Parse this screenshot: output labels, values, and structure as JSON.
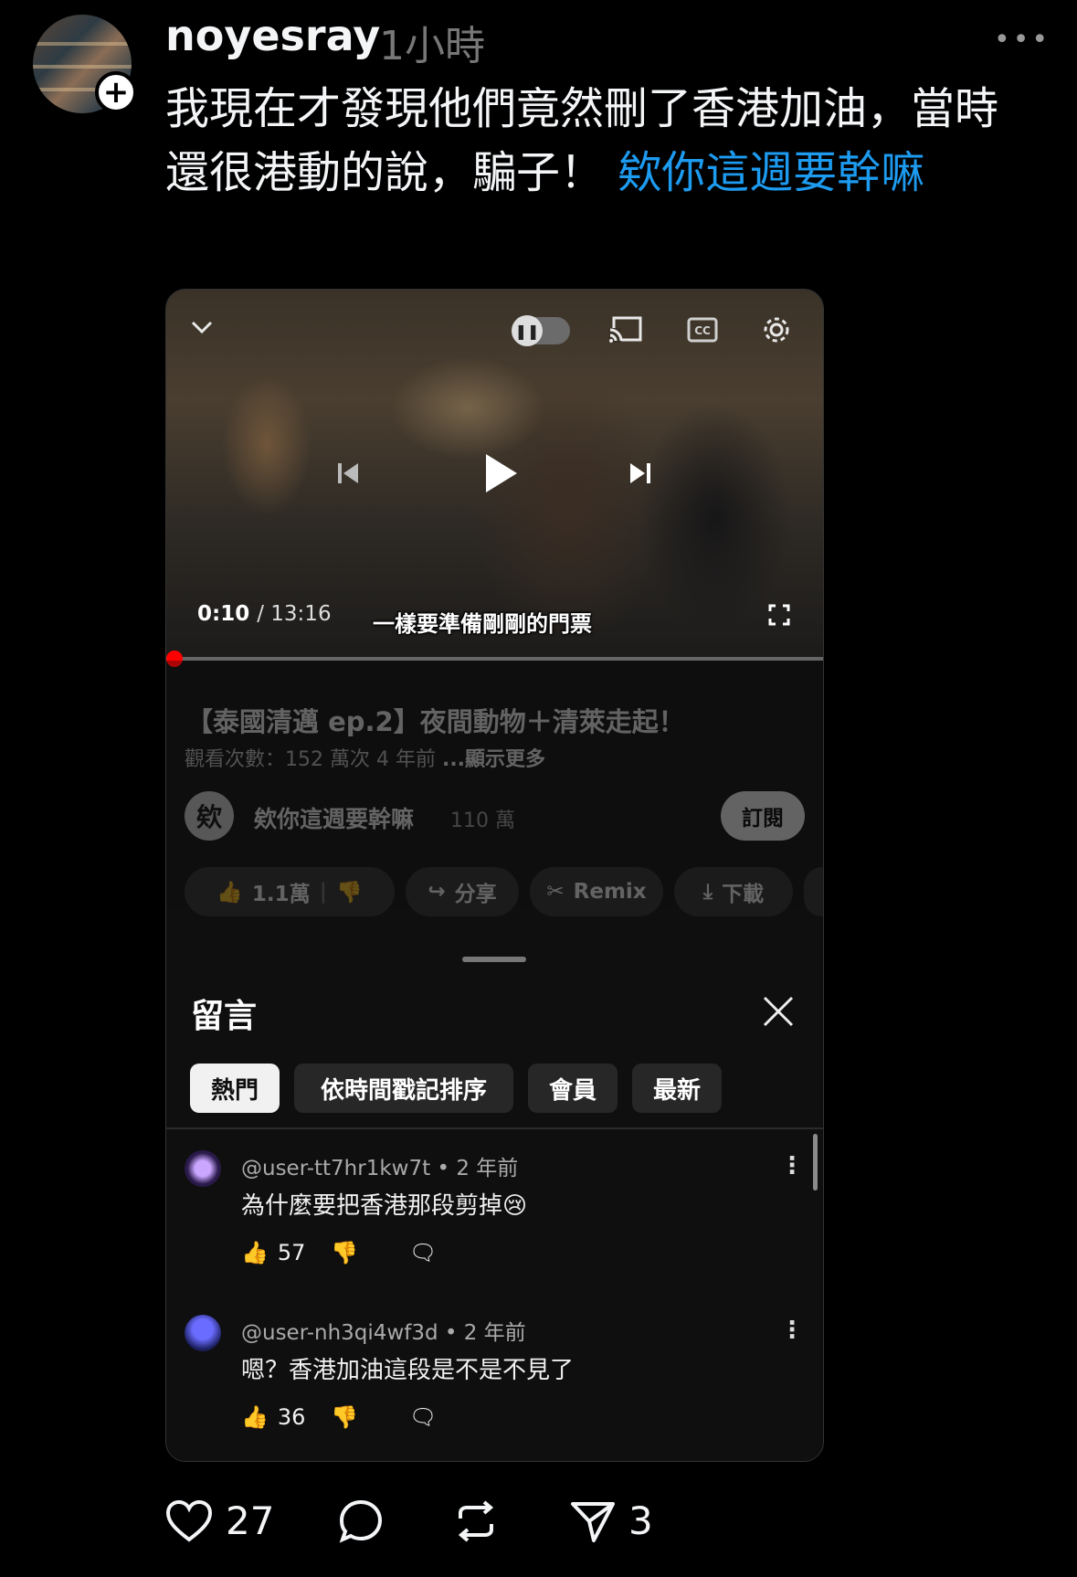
{
  "post": {
    "username": "noyesray",
    "time_ago": "1小時",
    "text": "我現在才發現他們竟然刪了香港加油，當時還很港動的說，騙子！ ",
    "link_text": "欸你這週要幹嘛"
  },
  "video": {
    "time_current": "0:10",
    "time_total": "/ 13:16",
    "subtitle": "一樣要準備剛剛的門票",
    "progress": 0.013,
    "title": "【泰國清邁 ep.2】夜間動物＋清萊走起！",
    "meta": "觀看次數：152 萬次  4 年前",
    "show_more": "...顯示更多",
    "channel_initial": "欸",
    "channel_name": "欸你這週要幹嘛",
    "subscribers": "110 萬",
    "subscribe_label": "訂閱",
    "likes": "1.1萬",
    "share_label": "分享",
    "remix_label": "Remix",
    "download_label": "下載"
  },
  "comments_panel": {
    "title": "留言",
    "chips": [
      "熱門",
      "依時間戳記排序",
      "會員",
      "最新"
    ],
    "comments": [
      {
        "user": "@user-tt7hr1kw7t",
        "time": "• 2 年前",
        "text": "為什麼要把香港那段剪掉😢",
        "likes": "57"
      },
      {
        "user": "@user-nh3qi4wf3d",
        "time": "• 2 年前",
        "text": "嗯？香港加油這段是不是不見了",
        "likes": "36"
      }
    ]
  },
  "actions": {
    "likes": "27",
    "reposts_label": "",
    "shares": "3"
  }
}
